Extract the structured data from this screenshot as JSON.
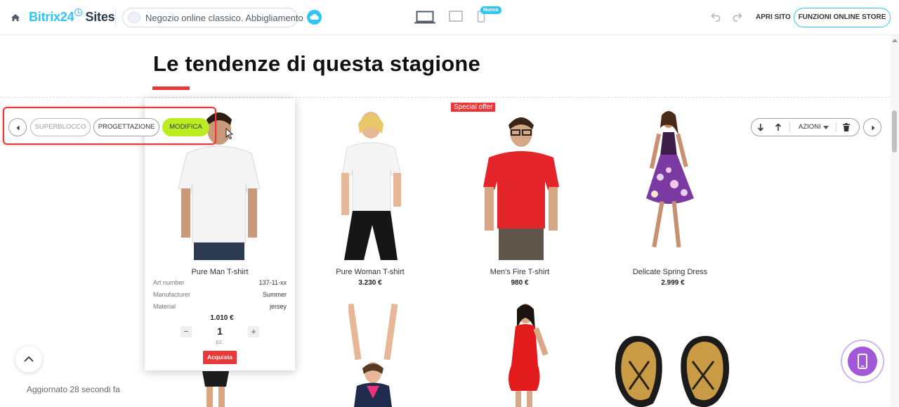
{
  "topbar": {
    "logo_brand": "Bitrix24",
    "logo_suffix": "Sites",
    "site_name": "Negozio online classico. Abbigliamento",
    "new_badge": "Nuovo",
    "open_site": "APRI SITO",
    "store_features": "FUNZIONI ONLINE STORE"
  },
  "section": {
    "heading": "Le tendenze di questa stagione"
  },
  "block_toolbar": {
    "superblock": "SUPERBLOCCO",
    "design": "PROGETTAZIONE",
    "edit": "MODIFICA",
    "actions": "AZIONI"
  },
  "products": [
    {
      "name": "Pure Man T-shirt",
      "price": "1.010 €",
      "specs": [
        {
          "label": "Art number",
          "value": "137-11-xx"
        },
        {
          "label": "Manufacturer",
          "value": "Summer"
        },
        {
          "label": "Material",
          "value": "jersey"
        }
      ],
      "quantity": "1",
      "unit": "pz.",
      "buy": "Acquista"
    },
    {
      "name": "Pure Woman T-shirt",
      "price": "3.230 €"
    },
    {
      "name": "Men's Fire T-shirt",
      "price": "980 €",
      "badge": "Special offer"
    },
    {
      "name": "Delicate Spring Dress",
      "price": "2.999 €"
    }
  ],
  "status": {
    "updated": "Aggiornato 28 secondi fa"
  },
  "colors": {
    "accent": "#2fc6f6",
    "red": "#e8383a",
    "edit_green": "#bbed21",
    "fab_purple": "#a258d8"
  }
}
